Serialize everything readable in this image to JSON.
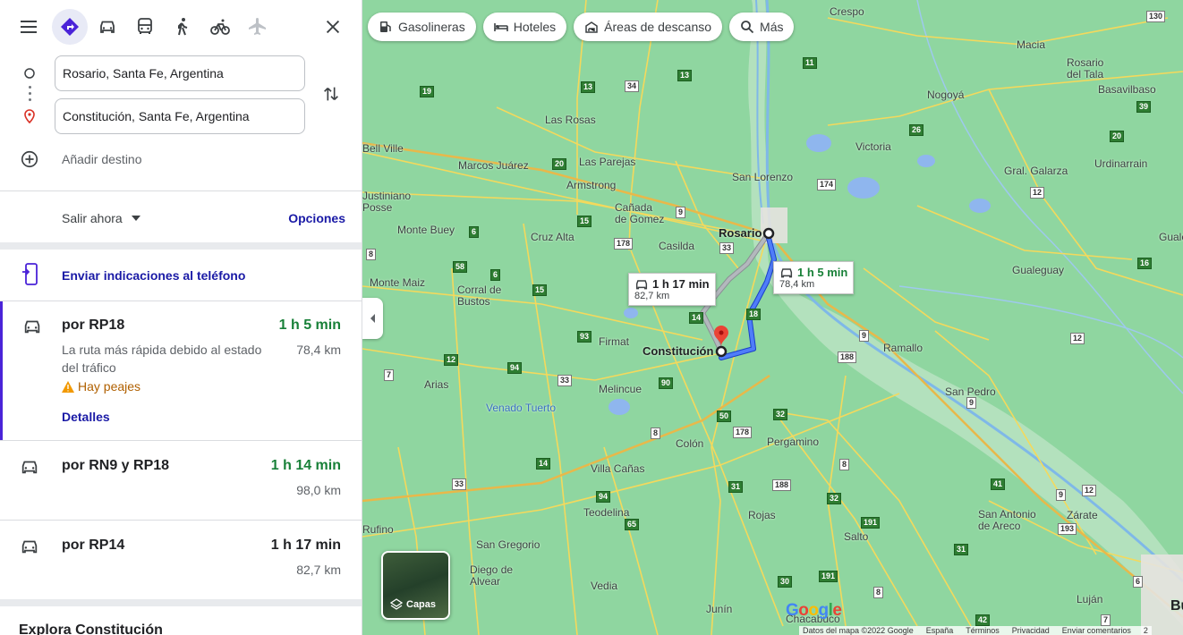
{
  "topbar": {
    "menu_icon": "menu-icon",
    "modes": [
      {
        "name": "best-route",
        "icon": "directions-icon",
        "active": true
      },
      {
        "name": "driving",
        "icon": "car-icon"
      },
      {
        "name": "transit",
        "icon": "bus-icon"
      },
      {
        "name": "walking",
        "icon": "walk-icon"
      },
      {
        "name": "cycling",
        "icon": "bike-icon"
      },
      {
        "name": "flights",
        "icon": "plane-icon"
      }
    ],
    "close_icon": "close-icon"
  },
  "inputs": {
    "origin": "Rosario, Santa Fe, Argentina",
    "destination": "Constitución, Santa Fe, Argentina",
    "add_destination": "Añadir destino"
  },
  "depart": {
    "label": "Salir ahora",
    "options": "Opciones"
  },
  "send_to_phone": "Enviar indicaciones al teléfono",
  "routes": [
    {
      "name": "por RP18",
      "time": "1 h 5 min",
      "distance": "78,4 km",
      "description": "La ruta más rápida debido al estado del tráfico",
      "warning": "Hay peajes",
      "details": "Detalles",
      "selected": true
    },
    {
      "name": "por RN9 y RP18",
      "time": "1 h 14 min",
      "distance": "98,0 km"
    },
    {
      "name": "por RP14",
      "time": "1 h 17 min",
      "distance": "82,7 km"
    }
  ],
  "explore": "Explora Constitución",
  "map": {
    "chips": [
      {
        "label": "Gasolineras",
        "icon": "gas-station-icon"
      },
      {
        "label": "Hoteles",
        "icon": "hotel-icon"
      },
      {
        "label": "Áreas de descanso",
        "icon": "rest-area-icon"
      },
      {
        "label": "Más",
        "icon": "search-icon"
      }
    ],
    "callouts": {
      "selected": {
        "time": "1 h 5 min",
        "distance": "78,4 km"
      },
      "alternative": {
        "time": "1 h 17 min",
        "distance": "82,7 km"
      }
    },
    "places": {
      "crespo": "Crespo",
      "macia": "Macia",
      "rosario_del_tala": "Rosario\ndel Tala",
      "basavilbaso": "Basavilbaso",
      "nogoya": "Nogoyá",
      "las_rosas": "Las Rosas",
      "bell_ville": "Bell Ville",
      "victoria": "Victoria",
      "marcos_juarez": "Marcos Juárez",
      "las_parejas": "Las Parejas",
      "gral_galarza": "Gral. Galarza",
      "urdinarrain": "Urdinarrain",
      "san_lorenzo": "San Lorenzo",
      "armstrong": "Armstrong",
      "justiniano_posse": "Justiniano\nPosse",
      "canada_de_gomez": "Cañada\nde Gomez",
      "rosario": "Rosario",
      "monte_buey": "Monte Buey",
      "cruz_alta": "Cruz Alta",
      "casilda": "Casilda",
      "gualeguay": "Gualeguay",
      "guale": "Guale",
      "monte_maiz": "Monte Maiz",
      "corral_de_bustos": "Corral de\nBustos",
      "firmat": "Firmat",
      "constitucion": "Constitución",
      "ramallo": "Ramallo",
      "arias": "Arias",
      "melincue": "Melincue",
      "san_pedro": "San Pedro",
      "venado_tuerto": "Venado Tuerto",
      "colon": "Colón",
      "pergamino": "Pergamino",
      "villa_canas": "Villa Cañas",
      "zarate": "Zárate",
      "teodelina": "Teodelina",
      "rojas": "Rojas",
      "san_antonio_de_areco": "San Antonio\nde Areco",
      "salto": "Salto",
      "rufino": "Rufino",
      "san_gregorio": "San Gregorio",
      "diego_de_alvear": "Diego de\nAlvear",
      "vedia": "Vedia",
      "chacabuco": "Chacabuco",
      "lujan": "Luján",
      "junin": "Junín",
      "bu": "Bu"
    },
    "collapse_icon": "chevron-left-icon",
    "layers_label": "Capas",
    "google": "Google",
    "footer": [
      "Datos del mapa ©2022 Google",
      "España",
      "Términos",
      "Privacidad",
      "Enviar comentarios",
      "2"
    ]
  }
}
